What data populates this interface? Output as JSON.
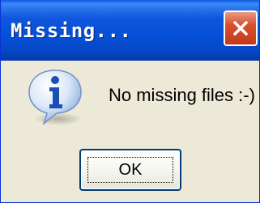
{
  "window": {
    "title": "Missing...",
    "close_icon": "close-x-icon",
    "colors": {
      "titlebar": "#0650d6",
      "close_button": "#d9502e",
      "body_background": "#ece9d8"
    }
  },
  "dialog": {
    "icon": "info-icon",
    "message": "No missing files :-)",
    "ok_label": "OK"
  }
}
